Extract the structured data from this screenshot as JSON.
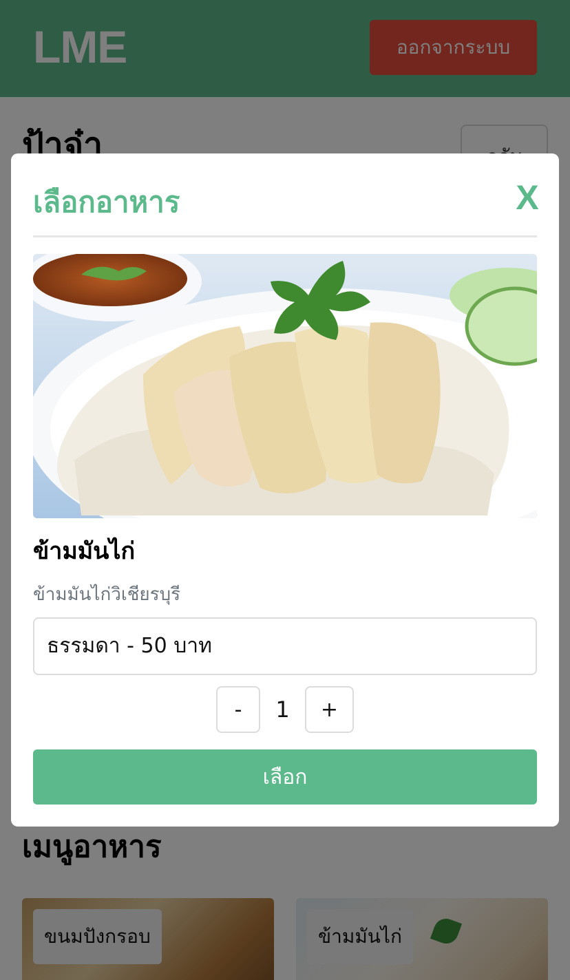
{
  "header": {
    "brand": "LME",
    "logout_label": "ออกจากระบบ"
  },
  "shop": {
    "title": "ป้าจ๋า",
    "back_label": "กลับ"
  },
  "menu": {
    "title": "เมนูอาหาร",
    "cards": [
      {
        "label": "ขนมปังกรอบ"
      },
      {
        "label": "ข้ามมันไก่"
      }
    ]
  },
  "modal": {
    "title": "เลือกอาหาร",
    "close_label": "X",
    "food_name": "ข้ามมันไก่",
    "food_desc": "ข้ามมันไก่วิเชียรบุรี",
    "selected_option": "ธรรมดา - 50 บาท",
    "qty_minus": "-",
    "qty_value": "1",
    "qty_plus": "+",
    "confirm_label": "เลือก"
  },
  "colors": {
    "brand_green": "#5cb98b",
    "logout_red": "#e74c3c"
  }
}
